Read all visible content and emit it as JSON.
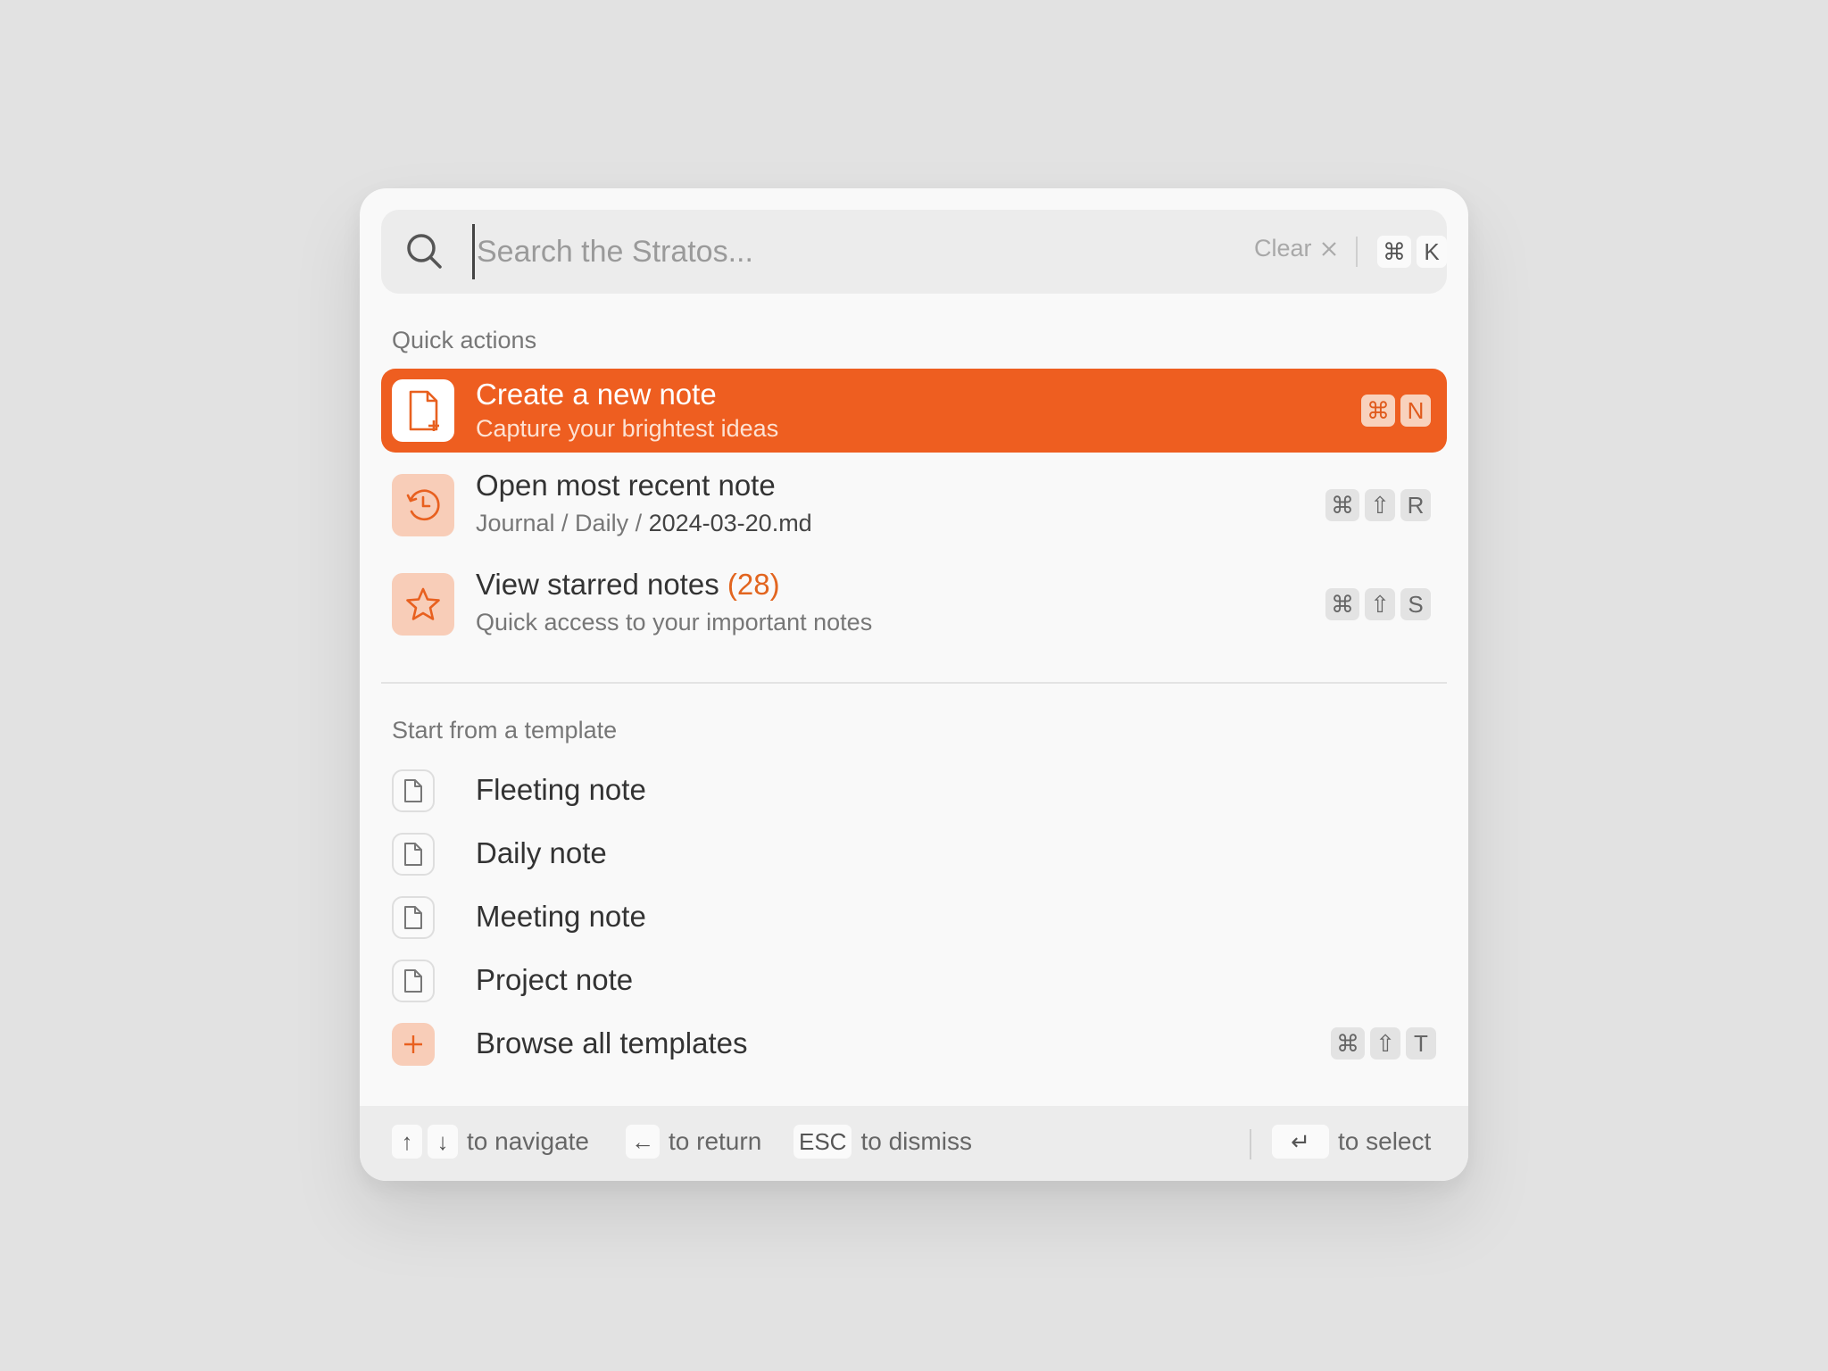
{
  "search": {
    "placeholder": "Search the Stratos...",
    "clear_label": "Clear",
    "shortcut": [
      "⌘",
      "K"
    ]
  },
  "quick_actions": {
    "label": "Quick actions",
    "items": [
      {
        "title": "Create a new note",
        "subtitle": "Capture your brightest ideas",
        "keys": [
          "⌘",
          "N"
        ]
      },
      {
        "title": "Open most recent note",
        "path_prefix": "Journal / Daily / ",
        "path_file": "2024-03-20.md",
        "keys": [
          "⌘",
          "⇧",
          "R"
        ]
      },
      {
        "title": "View starred notes",
        "count": "(28)",
        "subtitle": "Quick access to your important notes",
        "keys": [
          "⌘",
          "⇧",
          "S"
        ]
      }
    ]
  },
  "templates": {
    "label": "Start from a template",
    "items": [
      "Fleeting note",
      "Daily note",
      "Meeting note",
      "Project note"
    ],
    "browse_label": "Browse all templates",
    "browse_keys": [
      "⌘",
      "⇧",
      "T"
    ]
  },
  "footer": {
    "navigate_keys": [
      "↑",
      "↓"
    ],
    "navigate_label": "to navigate",
    "return_key": "←",
    "return_label": "to return",
    "dismiss_key": "ESC",
    "dismiss_label": "to dismiss",
    "select_key": "↵",
    "select_label": "to select"
  },
  "colors": {
    "accent": "#ee5e20",
    "accent_soft": "#f8cdb8",
    "background": "#e2e2e2",
    "panel": "#f9f9f9"
  }
}
